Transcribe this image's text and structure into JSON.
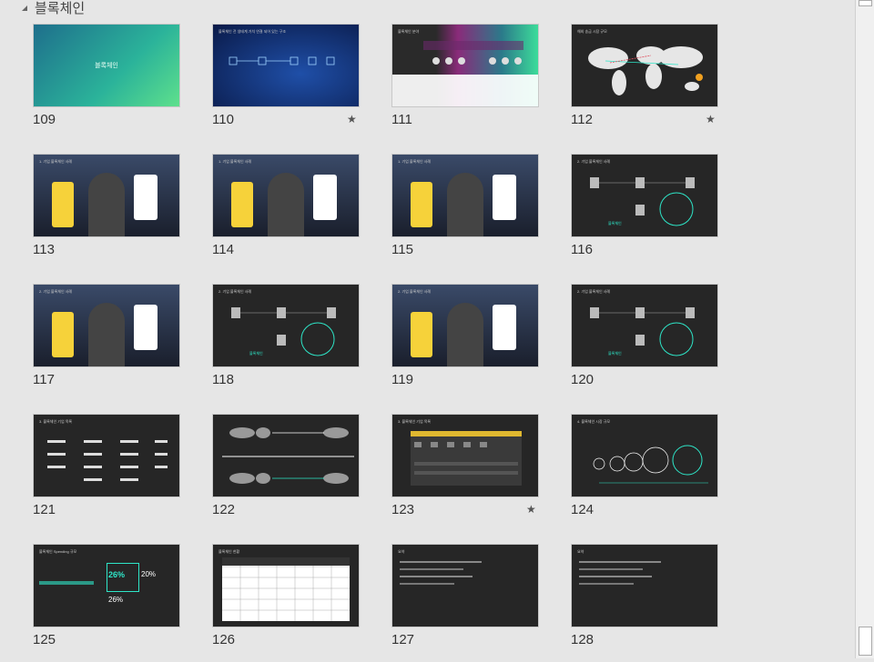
{
  "section": {
    "title": "블록체인",
    "arrow_icon": "collapse-triangle-icon"
  },
  "slides": [
    {
      "num": "109",
      "title": "블록체인",
      "starred": false,
      "theme": "gradient"
    },
    {
      "num": "110",
      "title": "블록체인 전 생태계 가치 연결 되어 있는 구조",
      "starred": true,
      "theme": "blue"
    },
    {
      "num": "111",
      "title": "블록체인 분야",
      "starred": false,
      "theme": "dark-gradient"
    },
    {
      "num": "112",
      "title": "해외 송금 시장 규모",
      "starred": true,
      "theme": "map"
    },
    {
      "num": "113",
      "title": "1. 기업 블록체인 사례",
      "starred": false,
      "theme": "photo"
    },
    {
      "num": "114",
      "title": "1. 기업 블록체인 사례",
      "starred": false,
      "theme": "photo"
    },
    {
      "num": "115",
      "title": "1. 기업 블록체인 사례",
      "starred": false,
      "theme": "photo"
    },
    {
      "num": "116",
      "title": "2. 기업 블록체인 사례",
      "starred": false,
      "theme": "diagram"
    },
    {
      "num": "117",
      "title": "2. 기업 블록체인 사례",
      "starred": false,
      "theme": "photo"
    },
    {
      "num": "118",
      "title": "2. 기업 블록체인 사례",
      "starred": false,
      "theme": "diagram"
    },
    {
      "num": "119",
      "title": "2. 기업 블록체인 사례",
      "starred": false,
      "theme": "photo"
    },
    {
      "num": "120",
      "title": "2. 기업 블록체인 사례",
      "starred": false,
      "theme": "diagram"
    },
    {
      "num": "121",
      "title": "3. 블록체인 기업 목록",
      "starred": false,
      "theme": "logos"
    },
    {
      "num": "122",
      "title": "",
      "starred": false,
      "theme": "maps"
    },
    {
      "num": "123",
      "title": "3. 블록체인 기업 목록",
      "starred": true,
      "theme": "table"
    },
    {
      "num": "124",
      "title": "4. 블록체인 시장 규모",
      "starred": false,
      "theme": "circles"
    },
    {
      "num": "125",
      "title": "블록체인 Spending 규모",
      "starred": false,
      "theme": "treemap"
    },
    {
      "num": "126",
      "title": "블록체인 현황",
      "starred": false,
      "theme": "grid"
    },
    {
      "num": "127",
      "title": "요약",
      "starred": false,
      "theme": "text"
    },
    {
      "num": "128",
      "title": "요약",
      "starred": false,
      "theme": "text"
    }
  ],
  "treemap": {
    "a": "26%",
    "b": "20%",
    "c": "26%"
  },
  "star_icon": "★"
}
